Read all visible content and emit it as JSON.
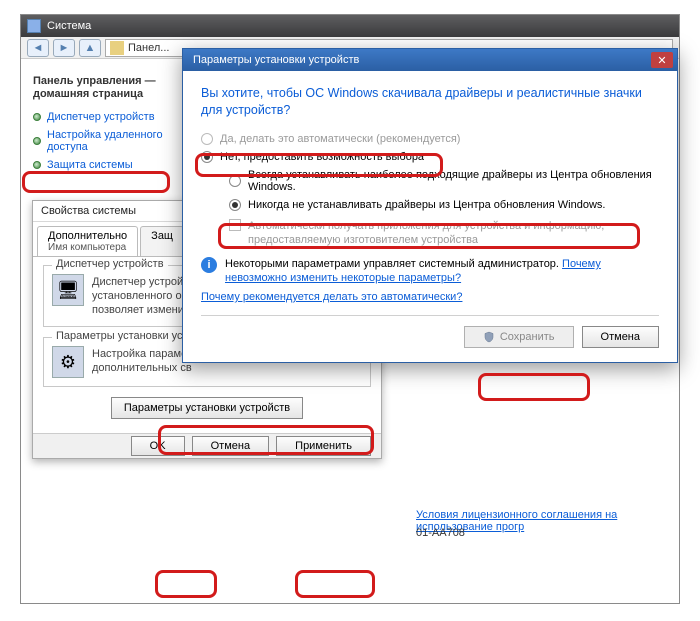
{
  "system_window": {
    "title": "Система",
    "breadcrumb": "Панел..."
  },
  "control_panel": {
    "home_line1": "Панель управления —",
    "home_line2": "домашняя страница",
    "links": [
      "Диспетчер устройств",
      "Настройка удаленного доступа",
      "Защита системы"
    ]
  },
  "system_props": {
    "title": "Свойства системы",
    "tabs": {
      "advanced": "Дополнительно",
      "protection": "Защ",
      "subline": "Имя компьютера"
    },
    "group1_legend": "Диспетчер устройств",
    "group1_text1": "Диспетчер устройс",
    "group1_text2": "установленного об",
    "group1_text3": "позволяет изменит",
    "group2_legend": "Параметры установки устрой",
    "group2_text1": "Настройка парамет",
    "group2_text2": "дополнительных св",
    "button": "Параметры установки устройств",
    "ok": "OK",
    "cancel": "Отмена",
    "apply": "Применить"
  },
  "dialog": {
    "title": "Параметры установки устройств",
    "question": "Вы хотите, чтобы ОС Windows скачивала драйверы и реалистичные значки для устройств?",
    "opt_yes": "Да, делать это автоматически (рекомендуется)",
    "opt_no": "Нет, предоставить возможность выбора",
    "sub_always": "Всегда устанавливать наиболее подходящие драйверы из Центра обновления Windows.",
    "sub_never": "Никогда не устанавливать драйверы из Центра обновления Windows.",
    "chk_apps": "Автоматически получать приложения для устройства и информацию, предоставляемую изготовителем устройства",
    "admin_note": "Некоторыми параметрами управляет системный администратор.",
    "admin_link": "Почему невозможно изменить некоторые параметры?",
    "auto_link": "Почему рекомендуется делать это автоматически?",
    "save": "Сохранить",
    "cancel": "Отмена"
  },
  "bg": {
    "license_link": "Условия лицензионного соглашения на использование прогр",
    "key_fragment": "01-AA708"
  }
}
